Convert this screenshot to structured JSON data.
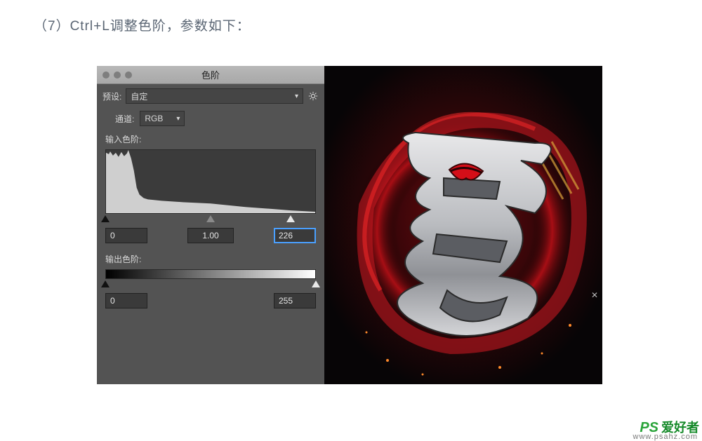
{
  "caption": "（7）Ctrl+L调整色阶，参数如下：",
  "dialog": {
    "title": "色阶",
    "preset_label": "预设:",
    "preset_value": "自定",
    "channel_label": "通道:",
    "channel_value": "RGB",
    "input_label": "输入色阶:",
    "input_black": "0",
    "input_gamma": "1.00",
    "input_white": "226",
    "output_label": "输出色阶:",
    "output_black": "0",
    "output_white": "255"
  },
  "watermark": {
    "brand_prefix": "PS",
    "brand_cn": "爱好者",
    "url": "www.psahz.com"
  },
  "colors": {
    "panel_bg": "#535353",
    "field_bg": "#3a3a3a",
    "accent": "#4aa0ff",
    "watermark": "#2aa43a",
    "preview_red": "#b50f16"
  }
}
